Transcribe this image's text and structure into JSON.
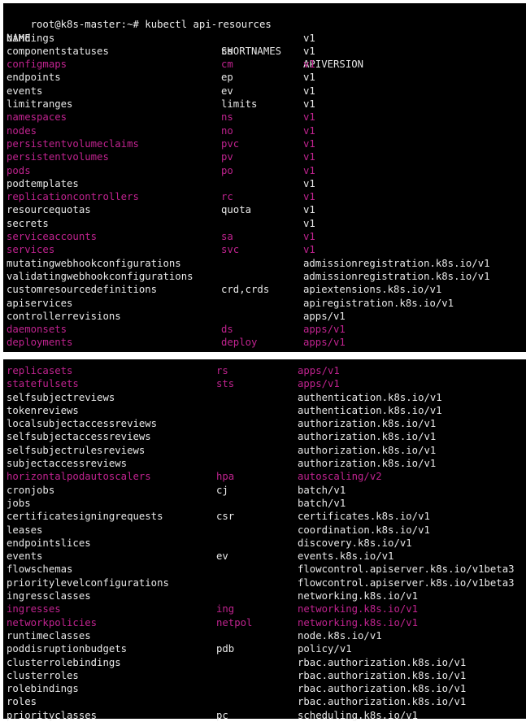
{
  "terminal": {
    "prompt": "root@k8s-master:~# kubectl api-resources",
    "headers": [
      "NAME",
      "SHORTNAMES",
      "APIVERSION"
    ],
    "accent_color": "#c0238f",
    "panel1_rows": [
      {
        "name": "bindings",
        "short": "",
        "api": "v1",
        "hl": false
      },
      {
        "name": "componentstatuses",
        "short": "cs",
        "api": "v1",
        "hl": false
      },
      {
        "name": "configmaps",
        "short": "cm",
        "api": "v1",
        "hl": true
      },
      {
        "name": "endpoints",
        "short": "ep",
        "api": "v1",
        "hl": false
      },
      {
        "name": "events",
        "short": "ev",
        "api": "v1",
        "hl": false
      },
      {
        "name": "limitranges",
        "short": "limits",
        "api": "v1",
        "hl": false
      },
      {
        "name": "namespaces",
        "short": "ns",
        "api": "v1",
        "hl": true
      },
      {
        "name": "nodes",
        "short": "no",
        "api": "v1",
        "hl": true
      },
      {
        "name": "persistentvolumeclaims",
        "short": "pvc",
        "api": "v1",
        "hl": true
      },
      {
        "name": "persistentvolumes",
        "short": "pv",
        "api": "v1",
        "hl": true
      },
      {
        "name": "pods",
        "short": "po",
        "api": "v1",
        "hl": true
      },
      {
        "name": "podtemplates",
        "short": "",
        "api": "v1",
        "hl": false
      },
      {
        "name": "replicationcontrollers",
        "short": "rc",
        "api": "v1",
        "hl": true
      },
      {
        "name": "resourcequotas",
        "short": "quota",
        "api": "v1",
        "hl": false
      },
      {
        "name": "secrets",
        "short": "",
        "api": "v1",
        "hl": false
      },
      {
        "name": "serviceaccounts",
        "short": "sa",
        "api": "v1",
        "hl": true
      },
      {
        "name": "services",
        "short": "svc",
        "api": "v1",
        "hl": true
      },
      {
        "name": "mutatingwebhookconfigurations",
        "short": "",
        "api": "admissionregistration.k8s.io/v1",
        "hl": false
      },
      {
        "name": "validatingwebhookconfigurations",
        "short": "",
        "api": "admissionregistration.k8s.io/v1",
        "hl": false
      },
      {
        "name": "customresourcedefinitions",
        "short": "crd,crds",
        "api": "apiextensions.k8s.io/v1",
        "hl": false
      },
      {
        "name": "apiservices",
        "short": "",
        "api": "apiregistration.k8s.io/v1",
        "hl": false
      },
      {
        "name": "controllerrevisions",
        "short": "",
        "api": "apps/v1",
        "hl": false
      },
      {
        "name": "daemonsets",
        "short": "ds",
        "api": "apps/v1",
        "hl": true
      },
      {
        "name": "deployments",
        "short": "deploy",
        "api": "apps/v1",
        "hl": true
      }
    ],
    "panel2_rows": [
      {
        "name": "replicasets",
        "short": "rs",
        "api": "apps/v1",
        "hl": true
      },
      {
        "name": "statefulsets",
        "short": "sts",
        "api": "apps/v1",
        "hl": true
      },
      {
        "name": "selfsubjectreviews",
        "short": "",
        "api": "authentication.k8s.io/v1",
        "hl": false
      },
      {
        "name": "tokenreviews",
        "short": "",
        "api": "authentication.k8s.io/v1",
        "hl": false
      },
      {
        "name": "localsubjectaccessreviews",
        "short": "",
        "api": "authorization.k8s.io/v1",
        "hl": false
      },
      {
        "name": "selfsubjectaccessreviews",
        "short": "",
        "api": "authorization.k8s.io/v1",
        "hl": false
      },
      {
        "name": "selfsubjectrulesreviews",
        "short": "",
        "api": "authorization.k8s.io/v1",
        "hl": false
      },
      {
        "name": "subjectaccessreviews",
        "short": "",
        "api": "authorization.k8s.io/v1",
        "hl": false
      },
      {
        "name": "horizontalpodautoscalers",
        "short": "hpa",
        "api": "autoscaling/v2",
        "hl": true
      },
      {
        "name": "cronjobs",
        "short": "cj",
        "api": "batch/v1",
        "hl": false
      },
      {
        "name": "jobs",
        "short": "",
        "api": "batch/v1",
        "hl": false
      },
      {
        "name": "certificatesigningrequests",
        "short": "csr",
        "api": "certificates.k8s.io/v1",
        "hl": false
      },
      {
        "name": "leases",
        "short": "",
        "api": "coordination.k8s.io/v1",
        "hl": false
      },
      {
        "name": "endpointslices",
        "short": "",
        "api": "discovery.k8s.io/v1",
        "hl": false
      },
      {
        "name": "events",
        "short": "ev",
        "api": "events.k8s.io/v1",
        "hl": false
      },
      {
        "name": "flowschemas",
        "short": "",
        "api": "flowcontrol.apiserver.k8s.io/v1beta3",
        "hl": false
      },
      {
        "name": "prioritylevelconfigurations",
        "short": "",
        "api": "flowcontrol.apiserver.k8s.io/v1beta3",
        "hl": false
      },
      {
        "name": "ingressclasses",
        "short": "",
        "api": "networking.k8s.io/v1",
        "hl": false
      },
      {
        "name": "ingresses",
        "short": "ing",
        "api": "networking.k8s.io/v1",
        "hl": true
      },
      {
        "name": "networkpolicies",
        "short": "netpol",
        "api": "networking.k8s.io/v1",
        "hl": true
      },
      {
        "name": "runtimeclasses",
        "short": "",
        "api": "node.k8s.io/v1",
        "hl": false
      },
      {
        "name": "poddisruptionbudgets",
        "short": "pdb",
        "api": "policy/v1",
        "hl": false
      },
      {
        "name": "clusterrolebindings",
        "short": "",
        "api": "rbac.authorization.k8s.io/v1",
        "hl": false
      },
      {
        "name": "clusterroles",
        "short": "",
        "api": "rbac.authorization.k8s.io/v1",
        "hl": false
      },
      {
        "name": "rolebindings",
        "short": "",
        "api": "rbac.authorization.k8s.io/v1",
        "hl": false
      },
      {
        "name": "roles",
        "short": "",
        "api": "rbac.authorization.k8s.io/v1",
        "hl": false
      },
      {
        "name": "priorityclasses",
        "short": "pc",
        "api": "scheduling.k8s.io/v1",
        "hl": false
      }
    ]
  }
}
